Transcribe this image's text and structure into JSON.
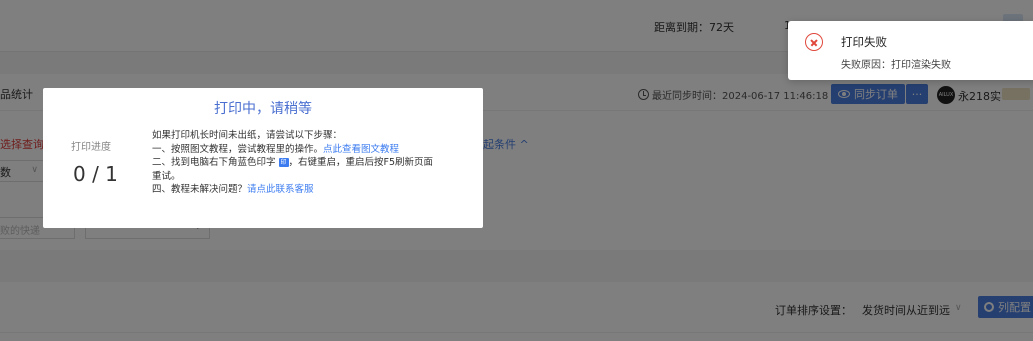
{
  "header": {
    "expiry": "距离到期：72天"
  },
  "panel": {
    "title_fragment": "品统计",
    "sync_time": "最近同步时间：2024-06-17 11:46:18",
    "sync_button": "同步订单",
    "more_button": "···",
    "shop_logo": "AILUX",
    "shop_name": "永218实"
  },
  "filters": {
    "red_label": "选择查询条",
    "select_value": "数",
    "collapse_link": "起条件 ^",
    "input_placeholder": "败的快递"
  },
  "list": {
    "sort_label": "订单排序设置：",
    "sort_value": "发货时间从近到远",
    "column_button": "列配置"
  },
  "print_modal": {
    "title": "打印中，请稍等",
    "progress_label": "打印进度",
    "progress_value": "0 / 1",
    "intro": "如果打印机长时间未出纸，请尝试以下步骤：",
    "step1_text": "一、按照图文教程，尝试教程里的操作。",
    "step1_link": "点此查看图文教程",
    "step2_text_a": "二、找到电脑右下角蓝色印字",
    "step2_tag": "印",
    "step2_text_b": "，右键重启，重启后按F5刷新页面",
    "step2_text_c": "重试。",
    "step4_text": "四、教程未解决问题？",
    "step4_link": "请点此联系客服"
  },
  "notification": {
    "title": "打印失败",
    "message": "失败原因：打印渲染失败"
  },
  "colors": {
    "primary": "#4a7fe3",
    "error": "#e0483c",
    "link": "#3c7cf0"
  }
}
